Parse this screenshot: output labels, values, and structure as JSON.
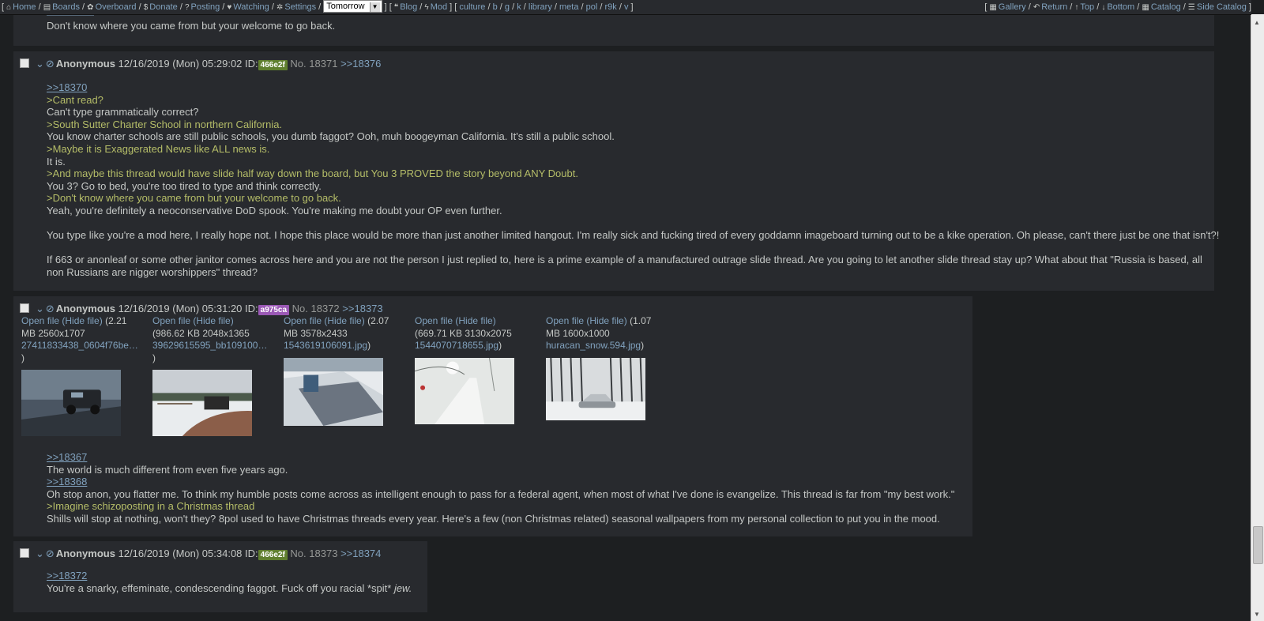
{
  "topbar": {
    "left": [
      {
        "icon": "home-icon",
        "glyph": "⌂",
        "label": "Home"
      },
      {
        "icon": "boards-icon",
        "glyph": "▤",
        "label": "Boards"
      },
      {
        "icon": "overboard-icon",
        "glyph": "✿",
        "label": "Overboard"
      },
      {
        "icon": "dollar-icon",
        "glyph": "$",
        "label": "Donate"
      },
      {
        "icon": "question-icon",
        "glyph": "?",
        "label": "Posting"
      },
      {
        "icon": "heart-icon",
        "glyph": "♥",
        "label": "Watching"
      },
      {
        "icon": "gear-icon",
        "glyph": "✲",
        "label": "Settings"
      }
    ],
    "theme_value": "Tomorrow",
    "blog_label": "Blog",
    "mod_label": "Mod",
    "boards": [
      "culture",
      "b",
      "g",
      "k",
      "library",
      "meta",
      "pol",
      "r9k",
      "v"
    ],
    "right": [
      {
        "icon": "gallery-icon",
        "glyph": "▦",
        "label": "Gallery"
      },
      {
        "icon": "return-icon",
        "glyph": "↶",
        "label": "Return"
      },
      {
        "icon": "up-arrow-icon",
        "glyph": "↑",
        "label": "Top"
      },
      {
        "icon": "down-arrow-icon",
        "glyph": "↓",
        "label": "Bottom"
      },
      {
        "icon": "catalog-icon",
        "glyph": "▦",
        "label": "Catalog"
      },
      {
        "icon": "list-icon",
        "glyph": "☰",
        "label": "Side Catalog"
      }
    ]
  },
  "prev_post_tail": "Don't know where you came from but your welcome to go back.",
  "posts": [
    {
      "name": "Anonymous",
      "date": "12/16/2019 (Mon) 05:29:02",
      "id_label": "ID:",
      "id": "466e2f",
      "id_color": "#5f7e2e",
      "no_label": "No.",
      "no": "18371",
      "replies": [
        ">>18376"
      ],
      "lines": [
        {
          "t": "ref",
          "text": ">>18370"
        },
        {
          "t": "quote",
          "text": ">Cant read?"
        },
        {
          "t": "text",
          "text": "Can't type grammatically correct?"
        },
        {
          "t": "quote",
          "text": ">South Sutter Charter School in northern California."
        },
        {
          "t": "text",
          "text": "You know charter schools are still public schools, you dumb faggot? Ooh, muh boogeyman California. It's still a public school."
        },
        {
          "t": "quote",
          "text": ">Maybe it is Exaggerated News like ALL news is."
        },
        {
          "t": "text",
          "text": "It is."
        },
        {
          "t": "quote",
          "text": ">And maybe this thread would have slide half way down the board, but You 3 PROVED the story beyond ANY Doubt."
        },
        {
          "t": "text",
          "text": "You 3? Go to bed, you're too tired to type and think correctly."
        },
        {
          "t": "quote",
          "text": ">Don't know where you came from but your welcome to go back."
        },
        {
          "t": "text",
          "text": "Yeah, you're definitely a neoconservative DoD spook. You're making me doubt your OP even further."
        },
        {
          "t": "blank",
          "text": ""
        },
        {
          "t": "text",
          "text": "You type like you're a mod here, I really hope not. I hope this place would be more than just another limited hangout. I'm really sick and fucking tired of every goddamn imageboard turning out to be a kike operation. Oh please, can't there just be one that isn't?!"
        },
        {
          "t": "blank",
          "text": ""
        },
        {
          "t": "text",
          "text": "If 663 or anonleaf or some other janitor comes across here and you are not the person I just replied to, here is a prime example of a manufactured outrage slide thread. Are you going to let another slide thread stay up? What about that \"Russia is based, all"
        },
        {
          "t": "text",
          "text": "non Russians are nigger worshippers\" thread?"
        }
      ]
    },
    {
      "name": "Anonymous",
      "date": "12/16/2019 (Mon) 05:31:20",
      "id_label": "ID:",
      "id": "a975ca",
      "id_color": "#9b59b6",
      "no_label": "No.",
      "no": "18372",
      "replies": [
        ">>18373"
      ],
      "files": [
        {
          "open": "Open file",
          "hide": "(Hide file)",
          "size": "2.21",
          "l2": "MB 2560x1707",
          "name": "27411833438_0604f76be…",
          "tail": ")",
          "pre": "(",
          "scene": "truck-storm"
        },
        {
          "open": "Open file",
          "hide": "(Hide file)",
          "size": "",
          "l2": "(986.62 KB 2048x1365",
          "name": "39629615595_bb109100…",
          "tail": ")",
          "pre": "",
          "scene": "truck-road"
        },
        {
          "open": "Open file",
          "hide": "(Hide file)",
          "size": "2.07",
          "l2": "MB 3578x2433",
          "name": "1543619106091.jpg",
          "tail": ")",
          "pre": "(",
          "scene": "roof"
        },
        {
          "open": "Open file",
          "hide": "(Hide file)",
          "size": "",
          "l2": "(669.71 KB 3130x2075",
          "name": "1544070718655.jpg",
          "tail": ")",
          "pre": "",
          "scene": "snow-path"
        },
        {
          "open": "Open file",
          "hide": "(Hide file)",
          "size": "1.07",
          "l2": "MB 1600x1000",
          "name": "huracan_snow.594.jpg",
          "tail": ")",
          "pre": "(",
          "scene": "car-forest"
        }
      ],
      "lines": [
        {
          "t": "ref",
          "text": ">>18367"
        },
        {
          "t": "text",
          "text": "The world is much different from even five years ago."
        },
        {
          "t": "ref",
          "text": ">>18368"
        },
        {
          "t": "text",
          "text": "Oh stop anon, you flatter me. To think my humble posts come across as intelligent enough to pass for a federal agent, when most of what I've done is evangelize. This thread is far from \"my best work.\""
        },
        {
          "t": "quote",
          "text": ">Imagine schizoposting in a Christmas thread"
        },
        {
          "t": "text",
          "text": "Shills will stop at nothing, won't they? 8pol used to have Christmas threads every year. Here's a few (non Christmas related) seasonal wallpapers from my personal collection to put you in the mood."
        }
      ]
    },
    {
      "name": "Anonymous",
      "date": "12/16/2019 (Mon) 05:34:08",
      "id_label": "ID:",
      "id": "466e2f",
      "id_color": "#5f7e2e",
      "no_label": "No.",
      "no": "18373",
      "replies": [
        ">>18374"
      ],
      "lines": [
        {
          "t": "ref",
          "text": ">>18372"
        },
        {
          "t": "text",
          "text": "You're a snarky, effeminate, condescending faggot. Fuck off you racial *spit* "
        },
        {
          "t": "em",
          "text": "jew."
        }
      ]
    }
  ]
}
